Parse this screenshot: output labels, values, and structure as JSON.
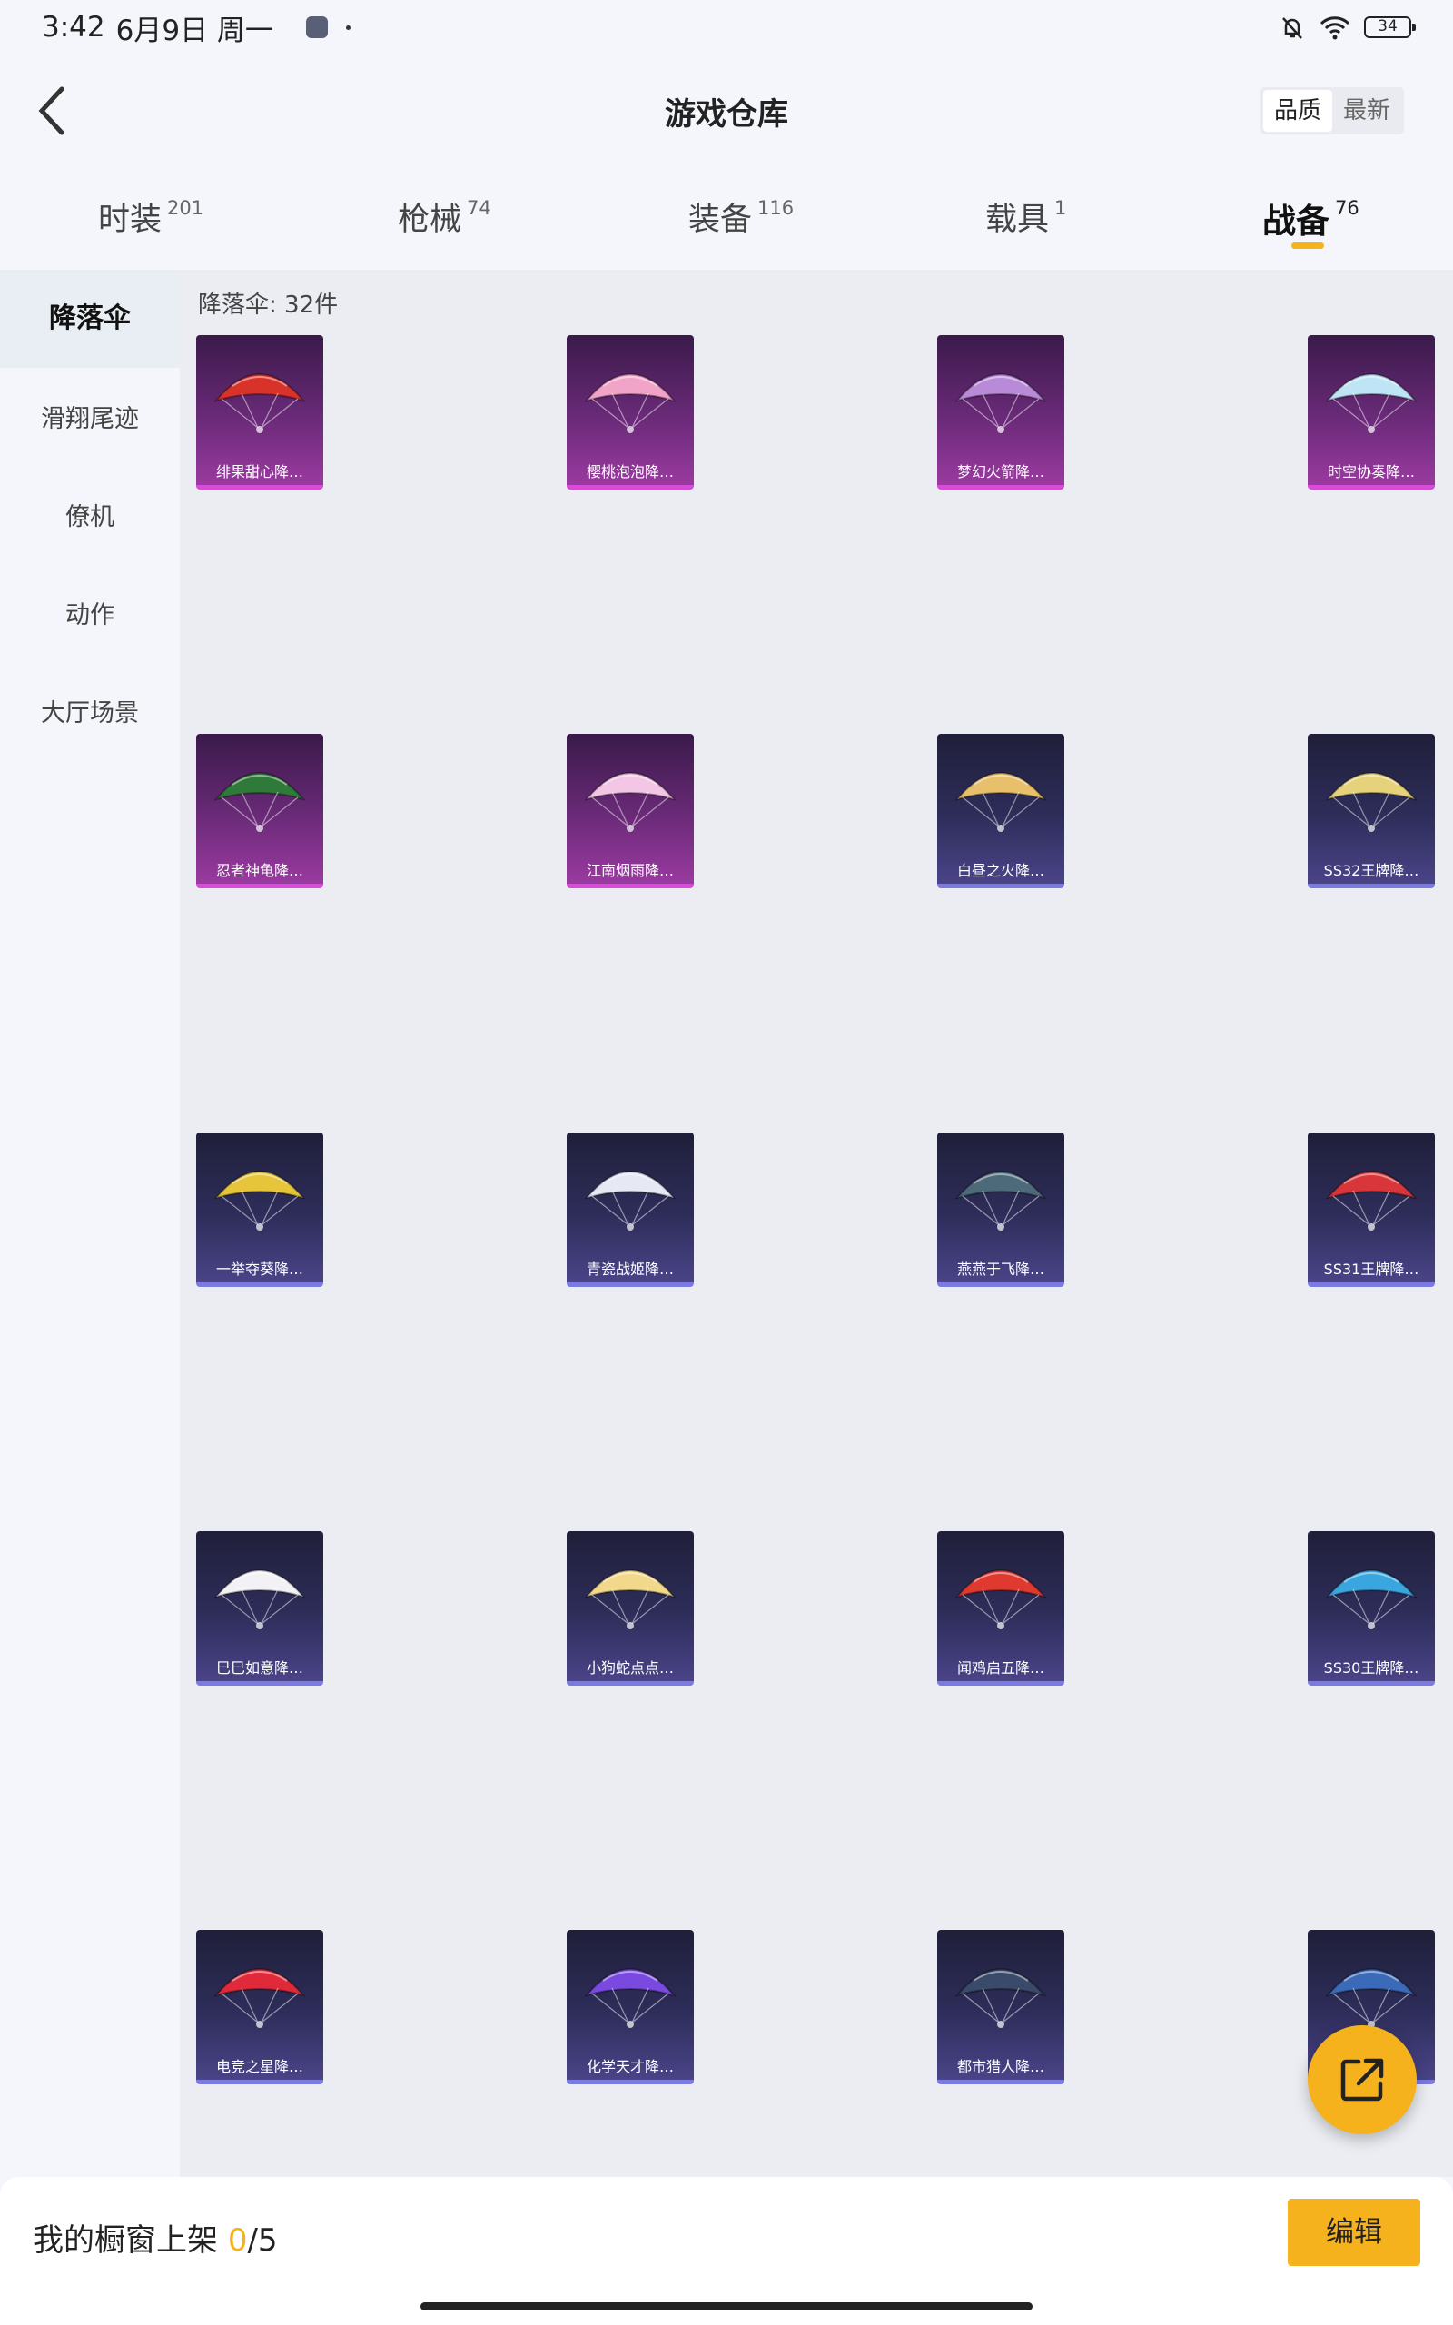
{
  "status_bar": {
    "time": "3:42",
    "date": "6月9日 周一",
    "battery": "34"
  },
  "header": {
    "title": "游戏仓库",
    "sort_options": [
      "品质",
      "最新"
    ]
  },
  "tabs": [
    {
      "label": "时装",
      "count": "201"
    },
    {
      "label": "枪械",
      "count": "74"
    },
    {
      "label": "装备",
      "count": "116"
    },
    {
      "label": "载具",
      "count": "1"
    },
    {
      "label": "战备",
      "count": "76"
    }
  ],
  "sidebar": {
    "items": [
      "降落伞",
      "滑翔尾迹",
      "僚机",
      "动作",
      "大厅场景"
    ]
  },
  "content": {
    "count_label": "降落伞: 32件",
    "items": [
      {
        "name": "绯果甜心降…",
        "rarity": "purple",
        "color": "#d8322a"
      },
      {
        "name": "樱桃泡泡降…",
        "rarity": "purple",
        "color": "#f2a4c8"
      },
      {
        "name": "梦幻火箭降…",
        "rarity": "purple",
        "color": "#b98ad8"
      },
      {
        "name": "时空协奏降…",
        "rarity": "purple",
        "color": "#bfe4f6"
      },
      {
        "name": "忍者神龟降…",
        "rarity": "purple",
        "color": "#2f7a3a"
      },
      {
        "name": "江南烟雨降…",
        "rarity": "purple",
        "color": "#f2c6e4"
      },
      {
        "name": "白昼之火降…",
        "rarity": "blue",
        "color": "#e8bf6a"
      },
      {
        "name": "SS32王牌降…",
        "rarity": "blue",
        "color": "#e6d27a"
      },
      {
        "name": "一举夺葵降…",
        "rarity": "blue",
        "color": "#e7c53a"
      },
      {
        "name": "青瓷战姬降…",
        "rarity": "blue",
        "color": "#e6e8f4"
      },
      {
        "name": "燕燕于飞降…",
        "rarity": "blue",
        "color": "#4c6a7a"
      },
      {
        "name": "SS31王牌降…",
        "rarity": "blue",
        "color": "#d8363a"
      },
      {
        "name": "巳巳如意降…",
        "rarity": "blue",
        "color": "#f2f2f6"
      },
      {
        "name": "小狗蛇点点…",
        "rarity": "blue",
        "color": "#f2d88a"
      },
      {
        "name": "闻鸡启五降…",
        "rarity": "blue",
        "color": "#e03a30"
      },
      {
        "name": "SS30王牌降…",
        "rarity": "blue",
        "color": "#3aa6e0"
      },
      {
        "name": "电竞之星降…",
        "rarity": "blue",
        "color": "#e02a3a"
      },
      {
        "name": "化学天才降…",
        "rarity": "blue",
        "color": "#7a4ae0"
      },
      {
        "name": "都市猎人降…",
        "rarity": "blue",
        "color": "#3a4a6a"
      },
      {
        "name": "",
        "rarity": "blue",
        "color": "#3a6ab8"
      }
    ]
  },
  "bottom_bar": {
    "label": "我的橱窗上架 ",
    "current": "0",
    "separator": "/",
    "total": "5",
    "edit_label": "编辑"
  }
}
